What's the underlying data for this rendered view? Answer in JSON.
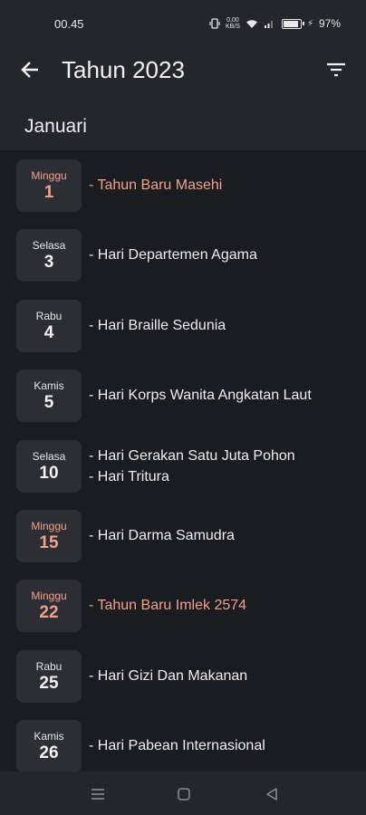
{
  "status_bar": {
    "time": "00.45",
    "network_speed": "0,00\nKB/S",
    "battery_percent": "97%"
  },
  "app_bar": {
    "title": "Tahun 2023",
    "back_icon": "arrow-left-icon",
    "filter_icon": "filter-icon"
  },
  "month": "Januari",
  "colors": {
    "background": "#1b1c20",
    "surface": "#24262b",
    "date_box": "#2c2e33",
    "holiday": "#f2a08f",
    "text": "#eeeeee"
  },
  "days": [
    {
      "day_name": "Minggu",
      "date": "1",
      "holiday": true,
      "events": [
        {
          "text": "- Tahun Baru Masehi",
          "holiday": true
        }
      ]
    },
    {
      "day_name": "Selasa",
      "date": "3",
      "holiday": false,
      "events": [
        {
          "text": "- Hari Departemen Agama",
          "holiday": false
        }
      ]
    },
    {
      "day_name": "Rabu",
      "date": "4",
      "holiday": false,
      "events": [
        {
          "text": "- Hari Braille Sedunia",
          "holiday": false
        }
      ]
    },
    {
      "day_name": "Kamis",
      "date": "5",
      "holiday": false,
      "events": [
        {
          "text": "- Hari Korps Wanita Angkatan Laut",
          "holiday": false
        }
      ]
    },
    {
      "day_name": "Selasa",
      "date": "10",
      "holiday": false,
      "events": [
        {
          "text": "- Hari Gerakan Satu Juta Pohon",
          "holiday": false
        },
        {
          "text": "- Hari Tritura",
          "holiday": false
        }
      ]
    },
    {
      "day_name": "Minggu",
      "date": "15",
      "holiday": true,
      "events": [
        {
          "text": "- Hari Darma Samudra",
          "holiday": false
        }
      ]
    },
    {
      "day_name": "Minggu",
      "date": "22",
      "holiday": true,
      "events": [
        {
          "text": "- Tahun Baru Imlek 2574",
          "holiday": true
        }
      ]
    },
    {
      "day_name": "Rabu",
      "date": "25",
      "holiday": false,
      "events": [
        {
          "text": "- Hari Gizi Dan Makanan",
          "holiday": false
        }
      ]
    },
    {
      "day_name": "Kamis",
      "date": "26",
      "holiday": false,
      "events": [
        {
          "text": "- Hari Pabean Internasional",
          "holiday": false
        }
      ]
    }
  ],
  "nav_bar": {
    "menu_icon": "menu-icon",
    "home_icon": "home-icon",
    "back_icon": "triangle-back-icon"
  }
}
